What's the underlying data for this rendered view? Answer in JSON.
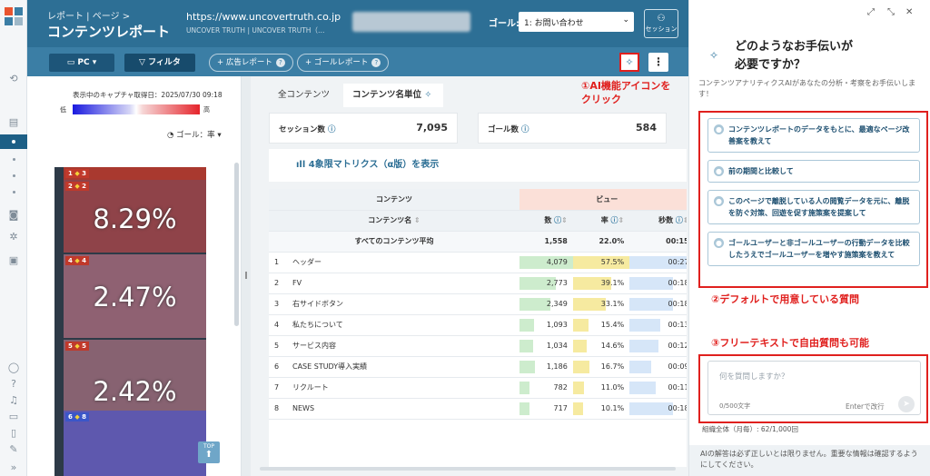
{
  "header": {
    "breadcrumb": "レポート | ページ >",
    "title": "コンテンツレポート",
    "url": "https://www.uncovertruth.co.jp",
    "site_name": "UNCOVER TRUTH | UNCOVER TRUTH（…",
    "goal_label": "ゴール:",
    "goal_value": "1: お問い合わせ",
    "session_label": "セッション"
  },
  "toolbar": {
    "device": "PC",
    "filter": "フィルタ",
    "ad_report": "+ 広告レポート",
    "goal_report": "+ ゴールレポート"
  },
  "heatmap": {
    "capture_caption": "表示中のキャプチャ取得日：2025/07/30 09:18",
    "low": "低",
    "high": "高",
    "goal_metric": "ゴール：率",
    "top_button": "TOP",
    "blocks": [
      {
        "rank": "1",
        "id": "3",
        "pct": "",
        "color": "#c0392b"
      },
      {
        "rank": "2",
        "id": "2",
        "pct": "8.29%",
        "color": "#e04a4a"
      },
      {
        "rank": "4",
        "id": "4",
        "pct": "2.47%",
        "color": "#b06f80"
      },
      {
        "rank": "5",
        "id": "5",
        "pct": "2.42%",
        "color": "#a6707f"
      },
      {
        "rank": "6",
        "id": "8",
        "pct": "",
        "color": "#6a60c8"
      }
    ]
  },
  "tabs": [
    "全コンテンツ",
    "コンテンツ名単位"
  ],
  "kpi": {
    "session_label": "セッション数",
    "session_value": "7,095",
    "goal_label": "ゴール数",
    "goal_value": "584"
  },
  "quadrant_link": "4象限マトリクス（α版）を表示",
  "table": {
    "group_header": "コンテンツ",
    "view_header": "ビュー",
    "name_header": "コンテンツ名",
    "col_count": "数",
    "col_rate": "率",
    "col_seconds": "秒数",
    "col_next": "数",
    "avg_label": "すべてのコンテンツ平均",
    "avg": {
      "count": "1,558",
      "rate": "22.0%",
      "sec": "00:15"
    },
    "rows": [
      {
        "n": "1",
        "name": "ヘッダー",
        "count": "4,079",
        "rate": "57.5%",
        "sec": "00:27",
        "cf": 1.0,
        "rf": 1.0,
        "sf": 1.0
      },
      {
        "n": "2",
        "name": "FV",
        "count": "2,773",
        "rate": "39.1%",
        "sec": "00:18",
        "cf": 0.68,
        "rf": 0.68,
        "sf": 0.67
      },
      {
        "n": "3",
        "name": "右サイドボタン",
        "count": "2,349",
        "rate": "33.1%",
        "sec": "00:18",
        "cf": 0.58,
        "rf": 0.58,
        "sf": 0.67
      },
      {
        "n": "4",
        "name": "私たちについて",
        "count": "1,093",
        "rate": "15.4%",
        "sec": "00:13",
        "cf": 0.27,
        "rf": 0.27,
        "sf": 0.48
      },
      {
        "n": "5",
        "name": "サービス内容",
        "count": "1,034",
        "rate": "14.6%",
        "sec": "00:12",
        "cf": 0.25,
        "rf": 0.25,
        "sf": 0.44
      },
      {
        "n": "6",
        "name": "CASE STUDY導入実績",
        "count": "1,186",
        "rate": "16.7%",
        "sec": "00:09",
        "cf": 0.29,
        "rf": 0.29,
        "sf": 0.33
      },
      {
        "n": "7",
        "name": "リクルート",
        "count": "782",
        "rate": "11.0%",
        "sec": "00:11",
        "cf": 0.19,
        "rf": 0.19,
        "sf": 0.41
      },
      {
        "n": "8",
        "name": "NEWS",
        "count": "717",
        "rate": "10.1%",
        "sec": "00:18",
        "cf": 0.18,
        "rf": 0.18,
        "sf": 0.67
      }
    ]
  },
  "annotations": {
    "a1_line1": "①AI機能アイコンを",
    "a1_line2": "クリック",
    "a2": "②デフォルトで用意している質問",
    "a3": "③フリーテキストで自由質問も可能"
  },
  "ai_panel": {
    "heading_line1": "どのようなお手伝いが",
    "heading_line2": "必要ですか？",
    "subtitle": "コンテンツアナリティクスAIがあなたの分析・考察をお手伝いします！",
    "suggestions": [
      "コンテンツレポートのデータをもとに、最適なページ改善案を教えて",
      "前の期間と比較して",
      "このページで離脱している人の閲覧データを元に、離脱を防ぐ対策、回遊を促す施策案を提案して",
      "ゴールユーザーと非ゴールユーザーの行動データを比較したうえでゴールユーザーを増やす施策案を教えて"
    ],
    "input_placeholder": "何を質問しますか？",
    "char_count": "0/500文字",
    "enter_hint": "Enterで改行",
    "usage": "組織全体（月毎）: 62/1,000回",
    "disclaimer": "AIの解答は必ず正しいとは限りません。重要な情報は確認するようにしてください。"
  },
  "colors": {
    "header": "#2d6f95",
    "toolbar": "#3b7ea5",
    "annotation_red": "#e0201e",
    "bar_green": "#cdeccd",
    "bar_yellow": "#f6eaa0",
    "bar_blue": "#d6e6f8"
  }
}
